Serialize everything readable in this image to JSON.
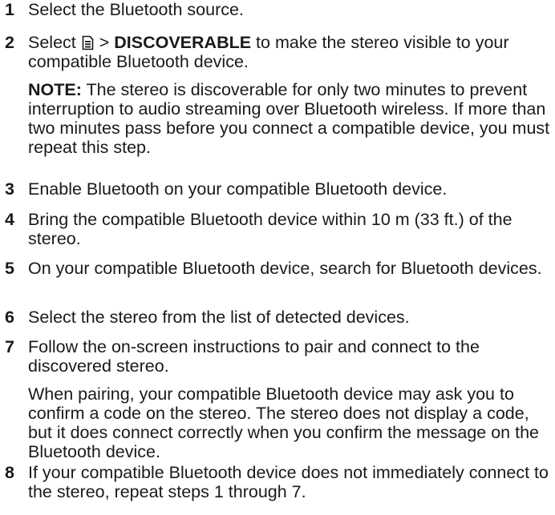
{
  "steps": [
    {
      "num": "1",
      "text": "Select the Bluetooth source."
    },
    {
      "num": "2",
      "pre": "Select ",
      "sep": " > ",
      "bold": "DISCOVERABLE",
      "post": " to make the stereo visible to your compatible Bluetooth device.",
      "icon": "menu-icon",
      "note_label": "NOTE:",
      "note_text": " The stereo is discoverable for only two minutes to prevent interruption to audio streaming over Bluetooth wireless. If more than two minutes pass before you connect a compatible device, you must repeat this step."
    },
    {
      "num": "3",
      "text": "Enable Bluetooth on your compatible Bluetooth device."
    },
    {
      "num": "4",
      "text": "Bring the compatible Bluetooth device within 10 m (33 ft.) of the stereo."
    },
    {
      "num": "5",
      "text": "On your compatible Bluetooth device, search for Bluetooth devices."
    },
    {
      "num": "6",
      "text": "Select the stereo from the list of detected devices."
    },
    {
      "num": "7",
      "text": "Follow the on-screen instructions to pair and connect to the discovered stereo.",
      "sub": "When pairing, your compatible Bluetooth device may ask you to confirm a code on the stereo. The stereo does not display a code, but it does connect correctly when you confirm the message on the Bluetooth device."
    },
    {
      "num": "8",
      "text": "If your compatible Bluetooth device does not immediately connect to the stereo, repeat steps 1 through 7."
    }
  ]
}
